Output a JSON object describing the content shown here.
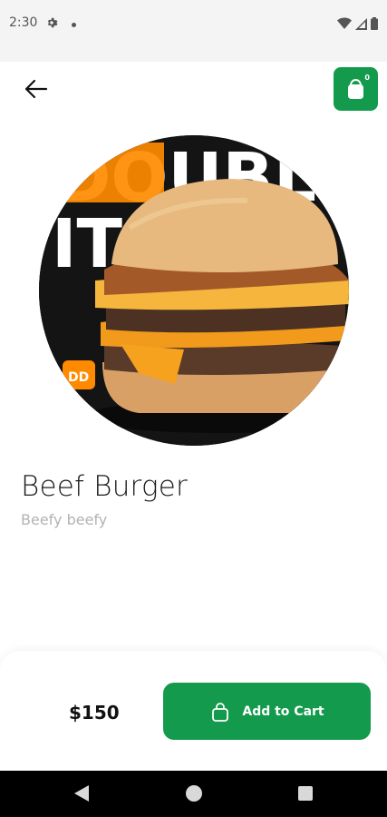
{
  "status_bar": {
    "time": "2:30"
  },
  "header": {
    "cart_count": "0"
  },
  "product": {
    "image_art_text": [
      "DOUBLE",
      "IT",
      "DD"
    ],
    "name": "Beef Burger",
    "description": "Beefy beefy"
  },
  "footer": {
    "price": "$150",
    "add_to_cart_label": "Add to Cart"
  },
  "colors": {
    "accent": "#139a4c",
    "poster_orange": "#ff8a00"
  },
  "icons": {
    "status": [
      "gear-icon",
      "wifi-icon",
      "cellular-icon",
      "battery-icon"
    ],
    "header": [
      "back-arrow-icon",
      "shopping-bag-icon"
    ],
    "button": "shopping-bag-icon",
    "nav": [
      "nav-back-icon",
      "nav-home-icon",
      "nav-recents-icon"
    ]
  }
}
